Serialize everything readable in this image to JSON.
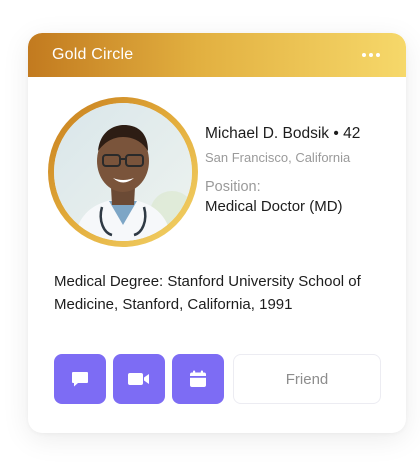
{
  "card": {
    "title": "Gold Circle",
    "more_icon": "more-horizontal-icon"
  },
  "profile": {
    "name_age": "Michael D. Bodsik • 42",
    "location": "San Francisco, California",
    "position_label": "Position:",
    "position_value": "Medical Doctor (MD)"
  },
  "degree": {
    "text": "Medical Degree:  Stanford University School of Medicine, Stanford, California, 1991"
  },
  "actions": {
    "chat_icon": "chat-icon",
    "video_icon": "video-camera-icon",
    "calendar_icon": "calendar-icon",
    "friend_label": "Friend"
  },
  "colors": {
    "accent": "#7d6cf4",
    "gold_start": "#c27a1f",
    "gold_end": "#f6d86a"
  }
}
